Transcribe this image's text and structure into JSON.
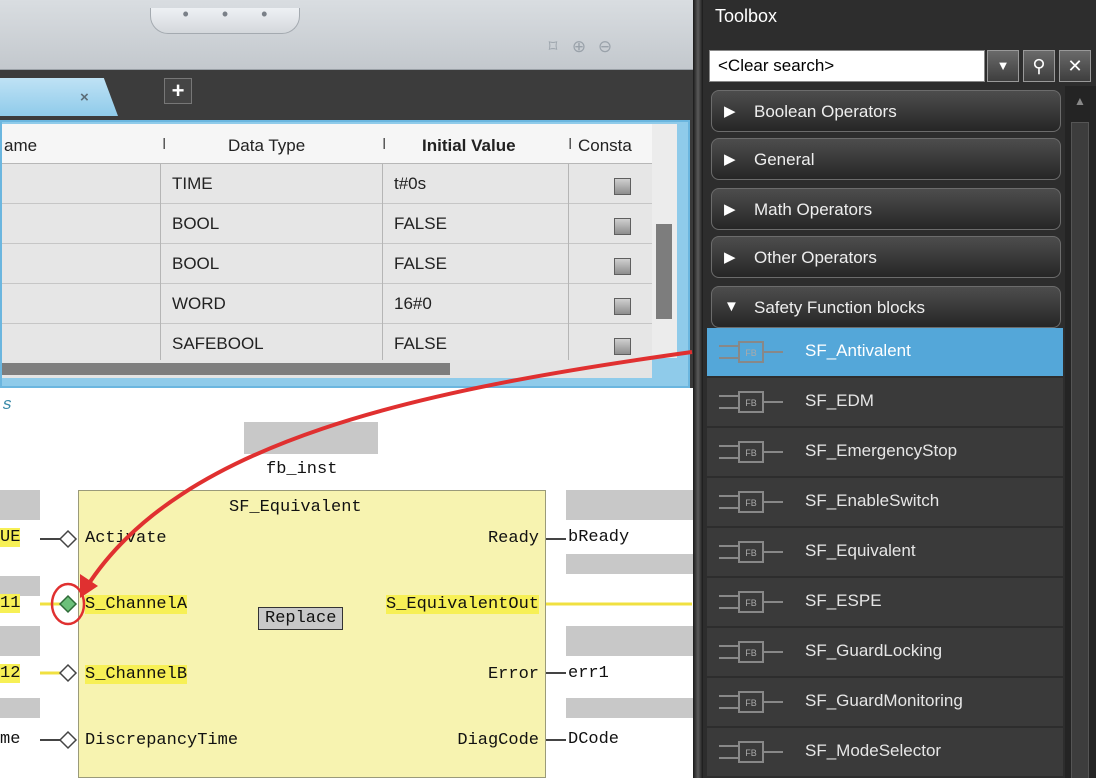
{
  "editor": {
    "zoom_icons": [
      "fit-icon",
      "zoom-in-icon",
      "zoom-out-icon"
    ],
    "tab_close": "×",
    "add_tab": "+",
    "variables": {
      "headers": [
        "ame",
        "Data Type",
        "Initial Value",
        "Consta"
      ],
      "rows": [
        {
          "type": "TIME",
          "init": "t#0s"
        },
        {
          "type": "BOOL",
          "init": "FALSE"
        },
        {
          "type": "BOOL",
          "init": "FALSE"
        },
        {
          "type": "WORD",
          "init": "16#0"
        },
        {
          "type": "SAFEBOOL",
          "init": "FALSE"
        }
      ]
    },
    "canvas": {
      "section_label": "s",
      "instance_name": "fb_inst",
      "fb_name": "SF_Equivalent",
      "inputs": [
        "Activate",
        "S_ChannelA",
        "S_ChannelB",
        "DiscrepancyTime"
      ],
      "outputs": [
        "Ready",
        "S_EquivalentOut",
        "Error",
        "DiagCode"
      ],
      "input_vars": [
        "UE",
        "11",
        "12",
        "me"
      ],
      "output_vars": [
        "bReady",
        "",
        "err1",
        "DCode"
      ],
      "replace_tooltip": "Replace"
    }
  },
  "toolbox": {
    "title": "Toolbox",
    "search_value": "<Clear search>",
    "categories": [
      {
        "label": "Boolean Operators",
        "expanded": false
      },
      {
        "label": "General",
        "expanded": false
      },
      {
        "label": "Math Operators",
        "expanded": false
      },
      {
        "label": "Other Operators",
        "expanded": false
      },
      {
        "label": "Safety Function blocks",
        "expanded": true
      }
    ],
    "fb_badge": "FB",
    "items": [
      "SF_Antivalent",
      "SF_EDM",
      "SF_EmergencyStop",
      "SF_EnableSwitch",
      "SF_Equivalent",
      "SF_ESPE",
      "SF_GuardLocking",
      "SF_GuardMonitoring",
      "SF_ModeSelector"
    ],
    "selected_item": "SF_Antivalent"
  },
  "colors": {
    "accent_blue": "#54a7d9",
    "highlight_yellow": "#f7f056",
    "fb_fill": "#f7f3b0",
    "annotation_red": "#e03030",
    "pin_green": "#6cc07a"
  }
}
